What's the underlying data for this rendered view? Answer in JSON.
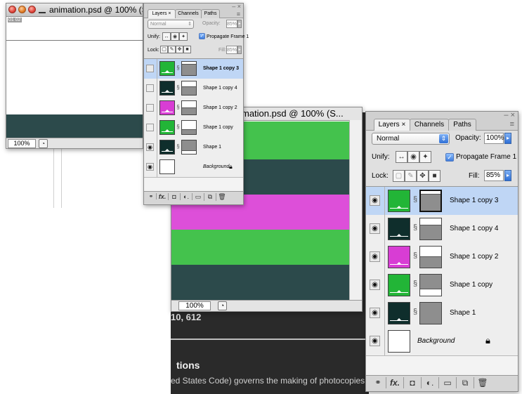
{
  "small_doc": {
    "title": "animation.psd @ 100% (S...",
    "corner_label": "01 02",
    "zoom": "100%"
  },
  "large_doc": {
    "title": "mation.psd @ 100% (S...",
    "zoom": "100%"
  },
  "background_page": {
    "number_text": "10, 612",
    "heading_text": "tions",
    "body_text": "ed States Code) governs the making of photocopies"
  },
  "layers_panel": {
    "tabs": [
      "Layers",
      "Channels",
      "Paths"
    ],
    "blend_mode": "Normal",
    "opacity_label": "Opacity:",
    "opacity_value_small": "85%",
    "opacity_value_large": "100%",
    "unify_label": "Unify:",
    "propagate_label": "Propagate Frame 1",
    "lock_label": "Lock:",
    "fill_label": "Fill:",
    "fill_value": "85%",
    "layers": [
      {
        "name": "Shape 1 copy 3",
        "color": "#22b537",
        "selected": true
      },
      {
        "name": "Shape 1 copy 4",
        "color": "#0f2e2c",
        "selected": false
      },
      {
        "name": "Shape 1 copy 2",
        "color": "#d83dd4",
        "selected": false
      },
      {
        "name": "Shape 1 copy",
        "color": "#22b537",
        "selected": false
      },
      {
        "name": "Shape 1",
        "color": "#0f2e2c",
        "selected": false
      },
      {
        "name": "Background",
        "color": "#ffffff",
        "selected": false
      }
    ],
    "bottom_buttons": [
      "link-icon",
      "fx-icon",
      "mask-icon",
      "adjustment-icon",
      "folder-icon",
      "new-layer-icon",
      "trash-icon"
    ]
  },
  "colors": {
    "green": "#44c24d",
    "teal": "#2c4a4b",
    "magenta": "#dd4fd9",
    "panel_bg": "#e0e0e0",
    "selection": "#bfd6f5"
  }
}
